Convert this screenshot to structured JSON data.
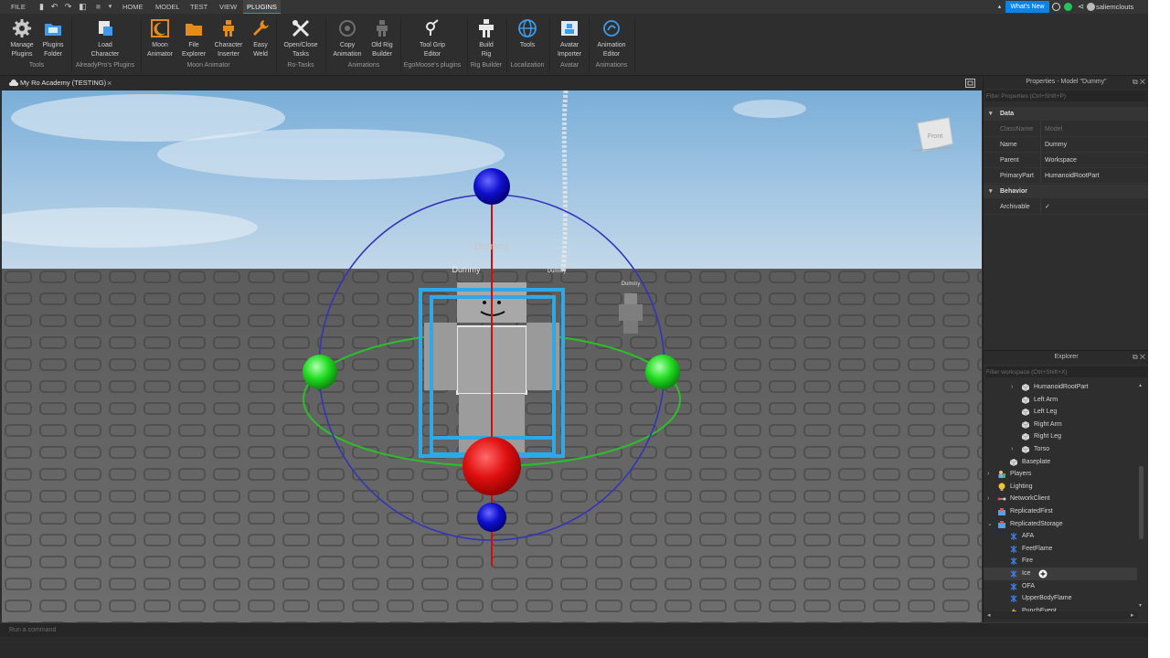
{
  "menubar": {
    "file": "FILE",
    "tabs": [
      "HOME",
      "MODEL",
      "TEST",
      "VIEW",
      "PLUGINS"
    ],
    "active_tab": "PLUGINS",
    "whats_new": "What's New",
    "username": "saliemclouts"
  },
  "ribbon": {
    "buttons": [
      {
        "label1": "Manage",
        "label2": "Plugins",
        "icon": "gear-icon"
      },
      {
        "label1": "Plugins",
        "label2": "Folder",
        "icon": "folder-icon"
      },
      {
        "label1": "Load",
        "label2": "Character",
        "icon": "load-character-icon"
      },
      {
        "label1": "Moon",
        "label2": "Animator",
        "icon": "moon-icon"
      },
      {
        "label1": "File",
        "label2": "Explorer",
        "icon": "folder-icon"
      },
      {
        "label1": "Character",
        "label2": "Inserter",
        "icon": "character-icon"
      },
      {
        "label1": "Easy",
        "label2": "Weld",
        "icon": "wrench-icon"
      },
      {
        "label1": "Open/Close",
        "label2": "Tasks",
        "icon": "tools-icon"
      },
      {
        "label1": "Copy",
        "label2": "Animation",
        "icon": "copy-animation-icon"
      },
      {
        "label1": "Old Rig",
        "label2": "Builder",
        "icon": "rig-icon"
      },
      {
        "label1": "Tool Grip",
        "label2": "Editor",
        "icon": "tool-grip-icon"
      },
      {
        "label1": "Build",
        "label2": "Rig",
        "icon": "build-rig-icon"
      },
      {
        "label1": "Tools",
        "label2": "",
        "icon": "globe-icon"
      },
      {
        "label1": "Avatar",
        "label2": "Importer",
        "icon": "avatar-importer-icon"
      },
      {
        "label1": "Animation",
        "label2": "Editor",
        "icon": "animation-editor-icon"
      }
    ],
    "groups": [
      "Tools",
      "AlreadyPro's Plugins",
      "Moon Animator",
      "Ro-Tasks",
      "Animations",
      "EgoMoose's plugins",
      "Rig Builder",
      "Localization",
      "Avatar",
      "Animations"
    ]
  },
  "document": {
    "tab_title": "My Ro Academy (TESTING)",
    "close": "×"
  },
  "viewport": {
    "view_cube_label": "Front",
    "name_tags": [
      "Dummy",
      "Dummy",
      "Dummy",
      "Dummy"
    ]
  },
  "command_bar": {
    "placeholder": "Run a command"
  },
  "properties": {
    "title": "Properties - Model \"Dummy\"",
    "filter_placeholder": "Filter Properties (Ctrl+Shift+P)",
    "sections": [
      {
        "name": "Data",
        "rows": [
          {
            "name": "ClassName",
            "value": "Model",
            "dim": true
          },
          {
            "name": "Name",
            "value": "Dummy",
            "dim": false
          },
          {
            "name": "Parent",
            "value": "Workspace",
            "dim": false
          },
          {
            "name": "PrimaryPart",
            "value": "HumanoidRootPart",
            "dim": false
          }
        ]
      },
      {
        "name": "Behavior",
        "rows": [
          {
            "name": "Archivable",
            "value": "✓",
            "dim": false
          }
        ]
      }
    ]
  },
  "explorer": {
    "title": "Explorer",
    "filter_placeholder": "Filter workspace (Ctrl+Shift+X)",
    "items": [
      {
        "label": "HumanoidRootPart",
        "indent": 3,
        "icon": "part-icon",
        "chevron": true
      },
      {
        "label": "Left Arm",
        "indent": 3,
        "icon": "part-icon",
        "chevron": false
      },
      {
        "label": "Left Leg",
        "indent": 3,
        "icon": "part-icon",
        "chevron": false
      },
      {
        "label": "Right Arm",
        "indent": 3,
        "icon": "part-icon",
        "chevron": false
      },
      {
        "label": "Right Leg",
        "indent": 3,
        "icon": "part-icon",
        "chevron": false
      },
      {
        "label": "Torso",
        "indent": 3,
        "icon": "part-icon",
        "chevron": true
      },
      {
        "label": "Baseplate",
        "indent": 2,
        "icon": "part-icon",
        "chevron": false
      },
      {
        "label": "Players",
        "indent": 1,
        "icon": "players-icon",
        "chevron": true
      },
      {
        "label": "Lighting",
        "indent": 1,
        "icon": "lighting-icon",
        "chevron": false
      },
      {
        "label": "NetworkClient",
        "indent": 1,
        "icon": "network-icon",
        "chevron": true
      },
      {
        "label": "ReplicatedFirst",
        "indent": 1,
        "icon": "replicated-icon",
        "chevron": false
      },
      {
        "label": "ReplicatedStorage",
        "indent": 1,
        "icon": "replicated-icon",
        "chevron": true,
        "expanded": true
      },
      {
        "label": "AFA",
        "indent": 2,
        "icon": "particle-icon",
        "chevron": false
      },
      {
        "label": "FeetFlame",
        "indent": 2,
        "icon": "particle-icon",
        "chevron": false
      },
      {
        "label": "Fire",
        "indent": 2,
        "icon": "particle-icon",
        "chevron": false
      },
      {
        "label": "Ice",
        "indent": 2,
        "icon": "particle-icon",
        "chevron": false,
        "hover": true
      },
      {
        "label": "OFA",
        "indent": 2,
        "icon": "particle-icon",
        "chevron": false
      },
      {
        "label": "UpperBodyFlame",
        "indent": 2,
        "icon": "particle-icon",
        "chevron": false
      },
      {
        "label": "PunchEvent",
        "indent": 2,
        "icon": "event-icon",
        "chevron": false
      }
    ]
  },
  "colors": {
    "accent": "#00a2ff",
    "whats_new_bg": "#0b84e6",
    "selection_box": "#2ea8e6",
    "handle_red": "#e01010",
    "handle_blue": "#1010d0",
    "handle_green": "#22dd22"
  }
}
